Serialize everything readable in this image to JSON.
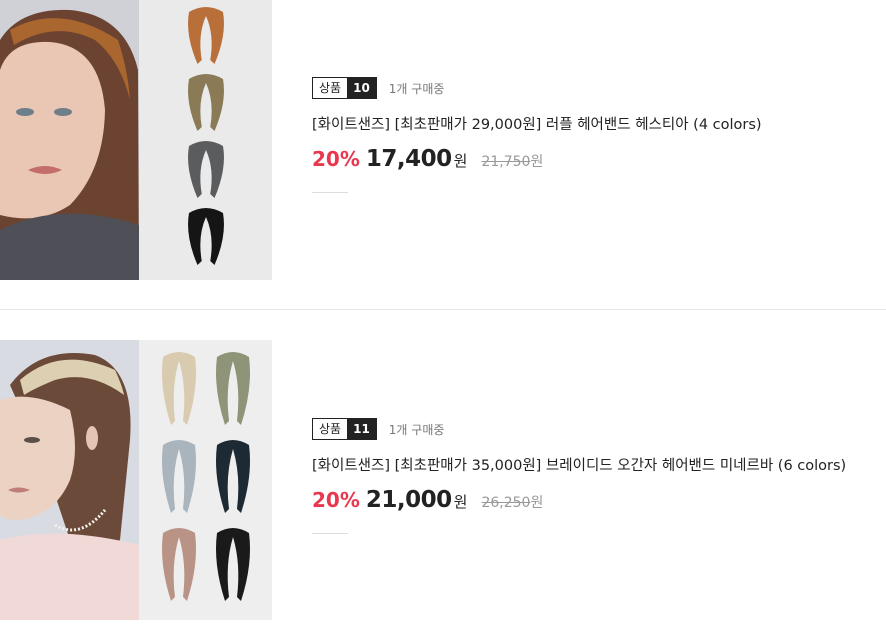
{
  "products": [
    {
      "rank_label": "상품",
      "rank_number": "10",
      "buying": "1개 구매중",
      "title": "[화이트샌즈] [최초판매가 29,000원] 러플 헤어밴드 헤스티아 (4 colors)",
      "discount": "20%",
      "price": "17,400",
      "currency": "원",
      "original_price": "21,750",
      "original_currency": "원",
      "swatch_colors": [
        "#b86f3a",
        "#8a7a55",
        "#5a5c5e",
        "#151515"
      ]
    },
    {
      "rank_label": "상품",
      "rank_number": "11",
      "buying": "1개 구매중",
      "title": "[화이트샌즈] [최초판매가 35,000원] 브레이디드 오간자 헤어밴드 미네르바 (6 colors)",
      "discount": "20%",
      "price": "21,000",
      "currency": "원",
      "original_price": "26,250",
      "original_currency": "원",
      "swatch_colors": [
        "#d9cbb0",
        "#8d9478",
        "#a9b4bd",
        "#1d2a33",
        "#b99486",
        "#1a1a1a"
      ]
    }
  ],
  "colors": {
    "discount": "#e8384f",
    "text": "#222222",
    "muted": "#999999"
  }
}
